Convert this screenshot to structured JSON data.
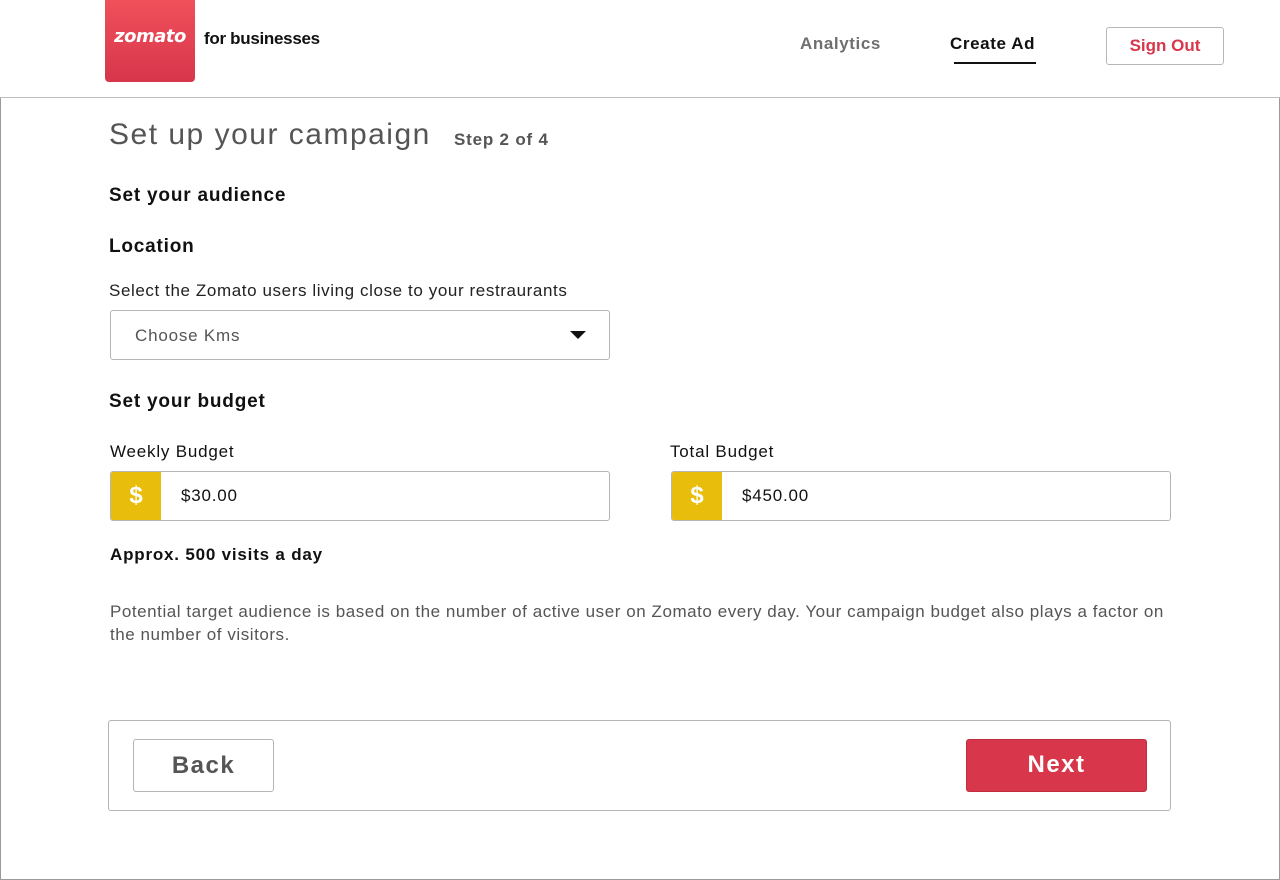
{
  "header": {
    "logo_text": "zomato",
    "logo_color": "#d7364b",
    "product_text": "for businesses",
    "nav": [
      {
        "label": "Analytics",
        "active": false
      },
      {
        "label": "Create Ad",
        "active": true
      }
    ],
    "sign_out_label": "Sign Out"
  },
  "main": {
    "title": "Set up your campaign",
    "step": "Step 2 of 4",
    "audience_heading": "Set your audience",
    "location": {
      "heading": "Location",
      "description": "Select the Zomato users living close to your restraurants",
      "select_value": "Choose Kms",
      "select_icon": "caret-down-icon"
    },
    "budget": {
      "heading": "Set your budget",
      "weekly": {
        "label": "Weekly Budget",
        "currency_symbol": "$",
        "value": "$30.00"
      },
      "total": {
        "label": "Total Budget",
        "currency_symbol": "$",
        "value": "$450.00"
      },
      "currency_color": "#e9bd0b"
    },
    "visits_estimate": "Approx. 500 visits a day",
    "info_text": "Potential target audience is based on the number of active user on Zomato every day. Your campaign budget also plays a factor on the number of visitors."
  },
  "footer": {
    "back_label": "Back",
    "next_label": "Next",
    "next_color": "#d8374b"
  }
}
